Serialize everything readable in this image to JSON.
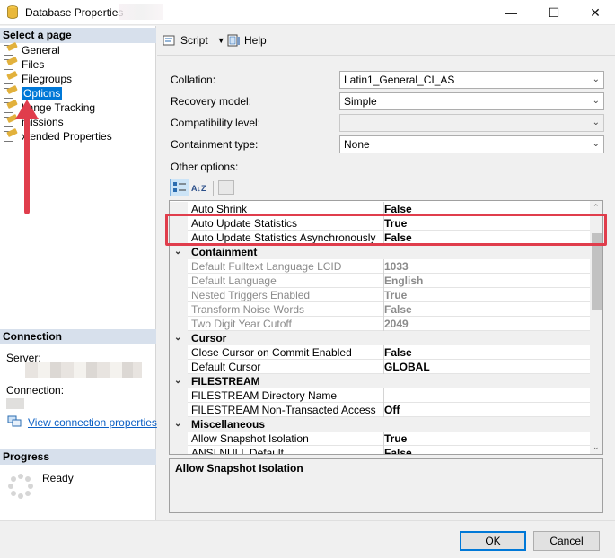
{
  "window": {
    "title": "Database Properties",
    "minimize_glyph": "—",
    "maximize_glyph": "☐",
    "close_glyph": "✕"
  },
  "left": {
    "select_page_header": "Select a page",
    "pages": [
      {
        "label": "General",
        "icon": "page-wrench-icon"
      },
      {
        "label": "Files",
        "icon": "page-wrench-icon"
      },
      {
        "label": "Filegroups",
        "icon": "page-wrench-icon"
      },
      {
        "label": "Options",
        "icon": "page-wrench-icon",
        "selected": true
      },
      {
        "label": "hange Tracking",
        "icon": "page-wrench-icon"
      },
      {
        "label": "missions",
        "icon": "page-wrench-icon"
      },
      {
        "label": "xtended Properties",
        "icon": "page-wrench-icon"
      }
    ],
    "connection_header": "Connection",
    "server_label": "Server:",
    "connection_label": "Connection:",
    "view_connection_link": "View connection properties",
    "progress_header": "Progress",
    "progress_status": "Ready"
  },
  "toolbar": {
    "script_label": "Script",
    "help_label": "Help"
  },
  "form": {
    "collation_label": "Collation:",
    "collation_value": "Latin1_General_CI_AS",
    "recovery_label": "Recovery model:",
    "recovery_value": "Simple",
    "compat_label": "Compatibility level:",
    "compat_value": "",
    "containment_label": "Containment type:",
    "containment_value": "None",
    "other_options_label": "Other options:",
    "sort_az_glyph": "A↓Z"
  },
  "grid": {
    "rows": [
      {
        "kind": "prop",
        "name": "Auto Shrink",
        "value": "False"
      },
      {
        "kind": "prop",
        "name": "Auto Update Statistics",
        "value": "True"
      },
      {
        "kind": "prop",
        "name": "Auto Update Statistics Asynchronously",
        "value": "False"
      },
      {
        "kind": "cat",
        "name": "Containment"
      },
      {
        "kind": "prop",
        "dim": true,
        "name": "Default Fulltext Language LCID",
        "value": "1033"
      },
      {
        "kind": "prop",
        "dim": true,
        "name": "Default Language",
        "value": "English"
      },
      {
        "kind": "prop",
        "dim": true,
        "name": "Nested Triggers Enabled",
        "value": "True"
      },
      {
        "kind": "prop",
        "dim": true,
        "name": "Transform Noise Words",
        "value": "False"
      },
      {
        "kind": "prop",
        "dim": true,
        "name": "Two Digit Year Cutoff",
        "value": "2049"
      },
      {
        "kind": "cat",
        "name": "Cursor"
      },
      {
        "kind": "prop",
        "name": "Close Cursor on Commit Enabled",
        "value": "False"
      },
      {
        "kind": "prop",
        "name": "Default Cursor",
        "value": "GLOBAL"
      },
      {
        "kind": "cat",
        "name": "FILESTREAM"
      },
      {
        "kind": "prop",
        "name": "FILESTREAM Directory Name",
        "value": ""
      },
      {
        "kind": "prop",
        "name": "FILESTREAM Non-Transacted Access",
        "value": "Off"
      },
      {
        "kind": "cat",
        "name": "Miscellaneous"
      },
      {
        "kind": "prop",
        "name": "Allow Snapshot Isolation",
        "value": "True"
      },
      {
        "kind": "prop",
        "name": "ANSI NULL Default",
        "value": "False"
      }
    ]
  },
  "description": {
    "title": "Allow Snapshot Isolation"
  },
  "footer": {
    "ok_label": "OK",
    "cancel_label": "Cancel"
  },
  "colors": {
    "accent": "#0078d7",
    "highlight_box": "#e03d4c",
    "section_header": "#d7e0ec"
  }
}
